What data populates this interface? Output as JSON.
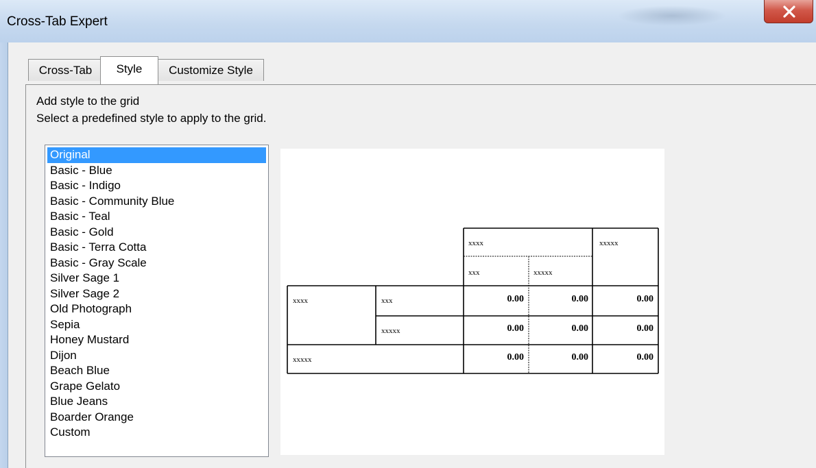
{
  "window": {
    "title": "Cross-Tab Expert",
    "close_glyph": "X"
  },
  "tabs": [
    {
      "label": "Cross-Tab",
      "active": false
    },
    {
      "label": "Style",
      "active": true
    },
    {
      "label": "Customize Style",
      "active": false
    }
  ],
  "panel": {
    "heading": "Add style to the grid",
    "instruction": "Select a predefined style to apply to the grid."
  },
  "styles": {
    "selected": "Original",
    "items": [
      "Original",
      "Basic - Blue",
      "Basic - Indigo",
      "Basic - Community Blue",
      "Basic - Teal",
      "Basic - Gold",
      "Basic - Terra Cotta",
      "Basic - Gray Scale",
      "Silver Sage 1",
      "Silver Sage 2",
      "Old Photograph",
      "Sepia",
      "Honey Mustard",
      "Dijon",
      "Beach Blue",
      "Grape Gelato",
      "Blue Jeans",
      "Boarder Orange",
      "Custom"
    ]
  },
  "preview": {
    "col_group_header": "xxxx",
    "col_total_header": "xxxxx",
    "col_headers": [
      "xxx",
      "xxxxx"
    ],
    "row_group_label": "xxxx",
    "row_sub_labels": [
      "xxx",
      "xxxxx"
    ],
    "row_total_label": "xxxxx",
    "cells": [
      [
        "0.00",
        "0.00",
        "0.00"
      ],
      [
        "0.00",
        "0.00",
        "0.00"
      ],
      [
        "0.00",
        "0.00",
        "0.00"
      ]
    ]
  },
  "colors": {
    "selection": "#3399ff",
    "close_button": "#c94536",
    "titlebar": "#c6d9ef"
  }
}
